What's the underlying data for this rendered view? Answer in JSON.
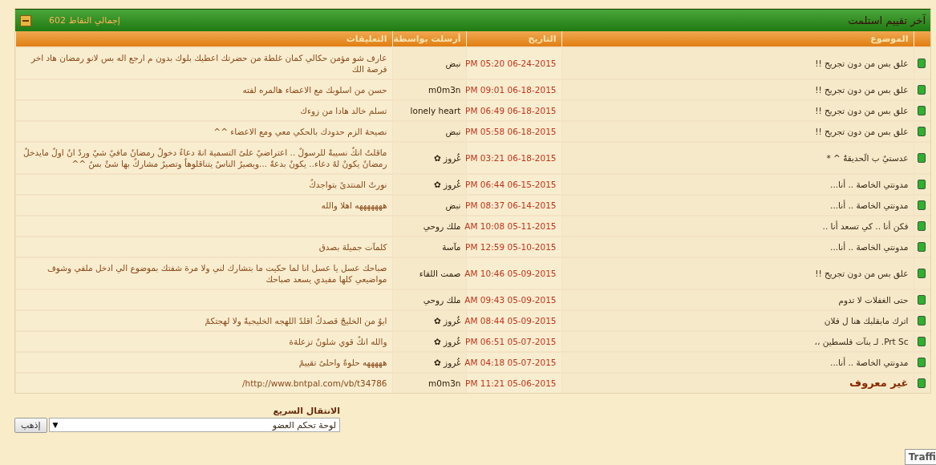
{
  "panel": {
    "title": "آخر تقييم استلمت",
    "total": "إجمالي النقاط 602",
    "collapsed": false
  },
  "table": {
    "columns": [
      "الموضوع",
      "التاريخ",
      "أرسلت بواسطة",
      "التعليقات"
    ],
    "rows": [
      {
        "kind": "thread",
        "subject": "علق بس من دون تجريح !!",
        "date": "06-24-2015 05:20 PM",
        "author": "نبض",
        "comment": "عارف شو مؤمن حكالي كمان غلطة من حضرتك اعطيك بلوك بدون م ارجع اله بس لانو رمضان هاد اخر فرصة الك"
      },
      {
        "kind": "thread",
        "subject": "علق بس من دون تجريح !!",
        "date": "06-18-2015 09:01 PM",
        "author": "m0m3n",
        "comment": "حسن من اسلوبك مع الاعضاء هالمره لفته"
      },
      {
        "kind": "thread",
        "subject": "علق بس من دون تجريح !!",
        "date": "06-18-2015 06:49 PM",
        "author": "lonely heart",
        "comment": "تسلم خالد هادا من زوءك"
      },
      {
        "kind": "thread",
        "subject": "علق بس من دون تجريح !!",
        "date": "06-18-2015 05:58 PM",
        "author": "نبض",
        "comment": "نصيحة الزم حدودك بالحكي معي ومع الاعضاء ^^"
      },
      {
        "kind": "thread",
        "subject": "عدستيٌ ب الَحديقةُ ^ *",
        "date": "06-18-2015 03:21 PM",
        "author": "غُروز ✿",
        "comment": "ماقلتٌ انكٌ نسيبةٌ للرسولٌ .. اعتراضيٌ علىٌ التسمية انهٌ دعاءٌ دخولٌ رمضانٌ مافيٌ شيٌ وردٌ انٌ اولٌ مايدخلٌ رمضانٌ يكونٌ لهٌ دعاء.. يكونٌ بدعةٌ ...ويصيرٌ الناسٌ يتناقلوهاٌ وتصيرٌ مشاركٌ بها شئٌ بسٌ ^^"
      },
      {
        "kind": "thread",
        "subject": "مدونتي الخاصة .. أنا...",
        "date": "06-15-2015 06:44 PM",
        "author": "غُروز ✿",
        "comment": "نورتٌ المنتدىٌ بتواجدكٌ"
      },
      {
        "kind": "thread",
        "subject": "مدونتي الخاصة .. أنا...",
        "date": "06-14-2015 08:37 PM",
        "author": "نبض",
        "comment": "هههههههه اهلا والله"
      },
      {
        "kind": "thread",
        "subject": "فكن أنا .. كي تسعد أنا ..",
        "date": "05-11-2015 10:08 AM",
        "author": "ملك روحي"
      },
      {
        "kind": "thread",
        "subject": "مدونتي الخاصة .. أنا...",
        "date": "05-10-2015 12:59 PM",
        "author": "مآسة",
        "comment": "كلمآت جميلة بصدق"
      },
      {
        "kind": "thread",
        "subject": "علق بس من دون تجريح !!",
        "date": "05-09-2015 10:46 AM",
        "author": "صمت اللقاء",
        "comment": "صباحك عسل يا عسل انا لما حكيت ما بتشارك لني ولا مرة شفتك بموضوع الي ادخل ملفي وشوف مواضيعي كلها مفيدي يسعد صباحك"
      },
      {
        "kind": "thread",
        "subject": "حتى الغفلات لا تدوم",
        "date": "05-09-2015 09:43 AM",
        "author": "ملك روحي"
      },
      {
        "kind": "thread",
        "subject": "اترك مابقلبك هنا ل فلان",
        "date": "05-09-2015 08:44 AM",
        "author": "غُروز ✿",
        "comment": "ايوٌ من الخليجٌ قصدكٌ اقلدٌ اللهجه الخليجيةٌ ولا لهجتكمٌ"
      },
      {
        "kind": "thread",
        "subject": "Prt Sc. لـ بنآت فلسطين ،،",
        "date": "05-07-2015 06:51 PM",
        "author": "غُروز ✿",
        "comment": "والله انكٌ قوي شلونٌ تزعلةة"
      },
      {
        "kind": "thread",
        "subject": "مدونتي الخاصة .. أنا...",
        "date": "05-07-2015 04:18 AM",
        "author": "غُروز ✿",
        "comment": "هههههه حلوةٌ واحلىٌ تقييمٌ"
      },
      {
        "kind": "unknown",
        "subject": "غير معروف",
        "date": "05-06-2015 11:21 PM",
        "author": "m0m3n",
        "comment": "http://www.bntpal.com/vb/t34786/"
      }
    ]
  },
  "quick_nav": {
    "label": "الانتقال السريع",
    "value": "لوحة تحكم العضو",
    "caret": "▼",
    "button": "إذهب"
  },
  "traffic_widget": "Traffi"
}
